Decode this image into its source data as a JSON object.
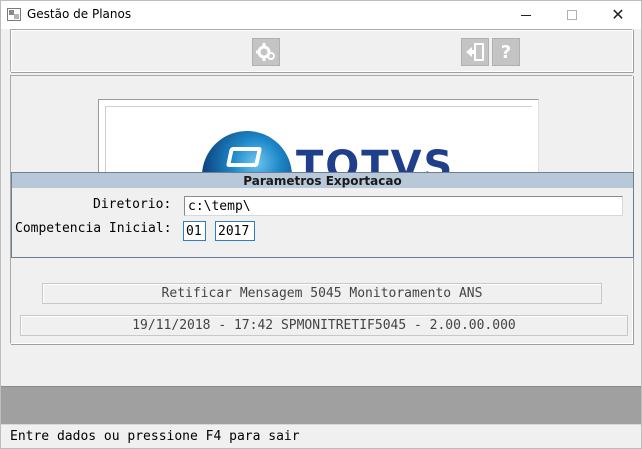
{
  "window": {
    "title": "Gestão de Planos"
  },
  "toolbar": {
    "confirm_icon": "gear-icon",
    "exit_icon": "exit-door-icon",
    "help_icon": "question-icon",
    "help_glyph": "?"
  },
  "logo": {
    "word": "TOTVS"
  },
  "params": {
    "header": "Parametros Exportacao",
    "diretorio_label": "Diretorio:",
    "diretorio_value": "c:\\temp\\",
    "competencia_label": "Competencia Inicial:",
    "competencia_month": "01",
    "competencia_year": "2017"
  },
  "info": {
    "title": "Retificar Mensagem 5045 Monitoramento ANS",
    "version_line": "19/11/2018 - 17:42  SPMONITRETIF5045 - 2.00.00.000"
  },
  "status": {
    "text": "Entre dados ou pressione F4 para sair"
  },
  "colors": {
    "header_bg": "#b8c8d8",
    "logo_blue": "#1f3f8a",
    "focus_border": "#2f7fc0"
  }
}
